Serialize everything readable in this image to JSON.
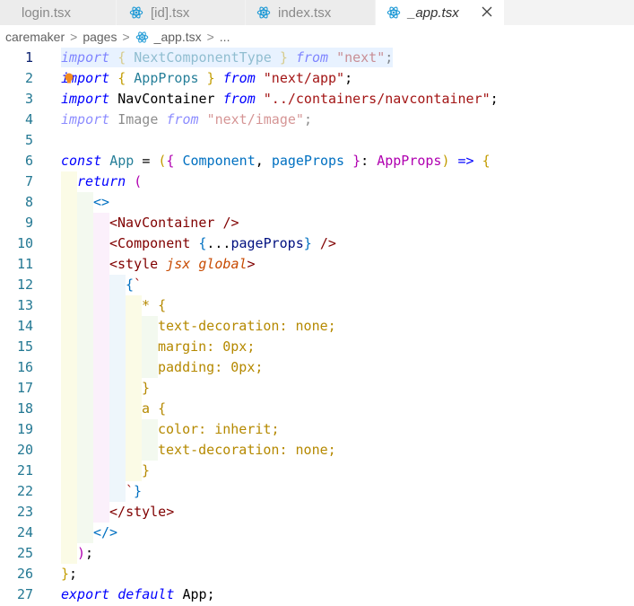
{
  "tabs": [
    {
      "label": "login.tsx",
      "active": false
    },
    {
      "label": "[id].tsx",
      "active": false
    },
    {
      "label": "index.tsx",
      "active": false
    },
    {
      "label": "_app.tsx",
      "active": true
    }
  ],
  "breadcrumb": {
    "parts": [
      "caremaker",
      "pages",
      "_app.tsx",
      "..."
    ]
  },
  "icons": {
    "tab_file": "react-icon",
    "close": "close-icon",
    "lightbulb": "lightbulb-icon"
  },
  "colors": {
    "react_icon": "#1f9ad6",
    "accent_line_number": "#0b216f"
  },
  "editor": {
    "active_line": 1,
    "lines": [
      {
        "n": "1"
      },
      {
        "n": "2"
      },
      {
        "n": "3"
      },
      {
        "n": "4"
      },
      {
        "n": "5"
      },
      {
        "n": "6"
      },
      {
        "n": "7"
      },
      {
        "n": "8"
      },
      {
        "n": "9"
      },
      {
        "n": "10"
      },
      {
        "n": "11"
      },
      {
        "n": "12"
      },
      {
        "n": "13"
      },
      {
        "n": "14"
      },
      {
        "n": "15"
      },
      {
        "n": "16"
      },
      {
        "n": "17"
      },
      {
        "n": "18"
      },
      {
        "n": "19"
      },
      {
        "n": "20"
      },
      {
        "n": "21"
      },
      {
        "n": "22"
      },
      {
        "n": "23"
      },
      {
        "n": "24"
      },
      {
        "n": "25"
      },
      {
        "n": "26"
      },
      {
        "n": "27"
      }
    ],
    "tokens": {
      "import": "import",
      "mport": "port",
      "from": "from",
      "const": "const",
      "return": "return",
      "export": "export",
      "default": "default",
      "NextComponentType": "NextComponentType",
      "AppProps": "AppProps",
      "NavContainer": "NavContainer",
      "Image": "Image",
      "App": "App",
      "Component": "Component",
      "pageProps": "pageProps",
      "next": "\"next\"",
      "next_app": "\"next/app\"",
      "containers": "\"../containers/navcontainer\"",
      "next_image": "\"next/image\"",
      "style": "style",
      "jsx": "jsx",
      "global": "global",
      "star": "*",
      "a": "a",
      "text_decoration": "text-decoration",
      "margin": "margin",
      "padding": "padding",
      "color": "color",
      "none": "none",
      "zero": "0px",
      "inherit": "inherit",
      "spread": "...",
      "arrow": "=>"
    }
  }
}
